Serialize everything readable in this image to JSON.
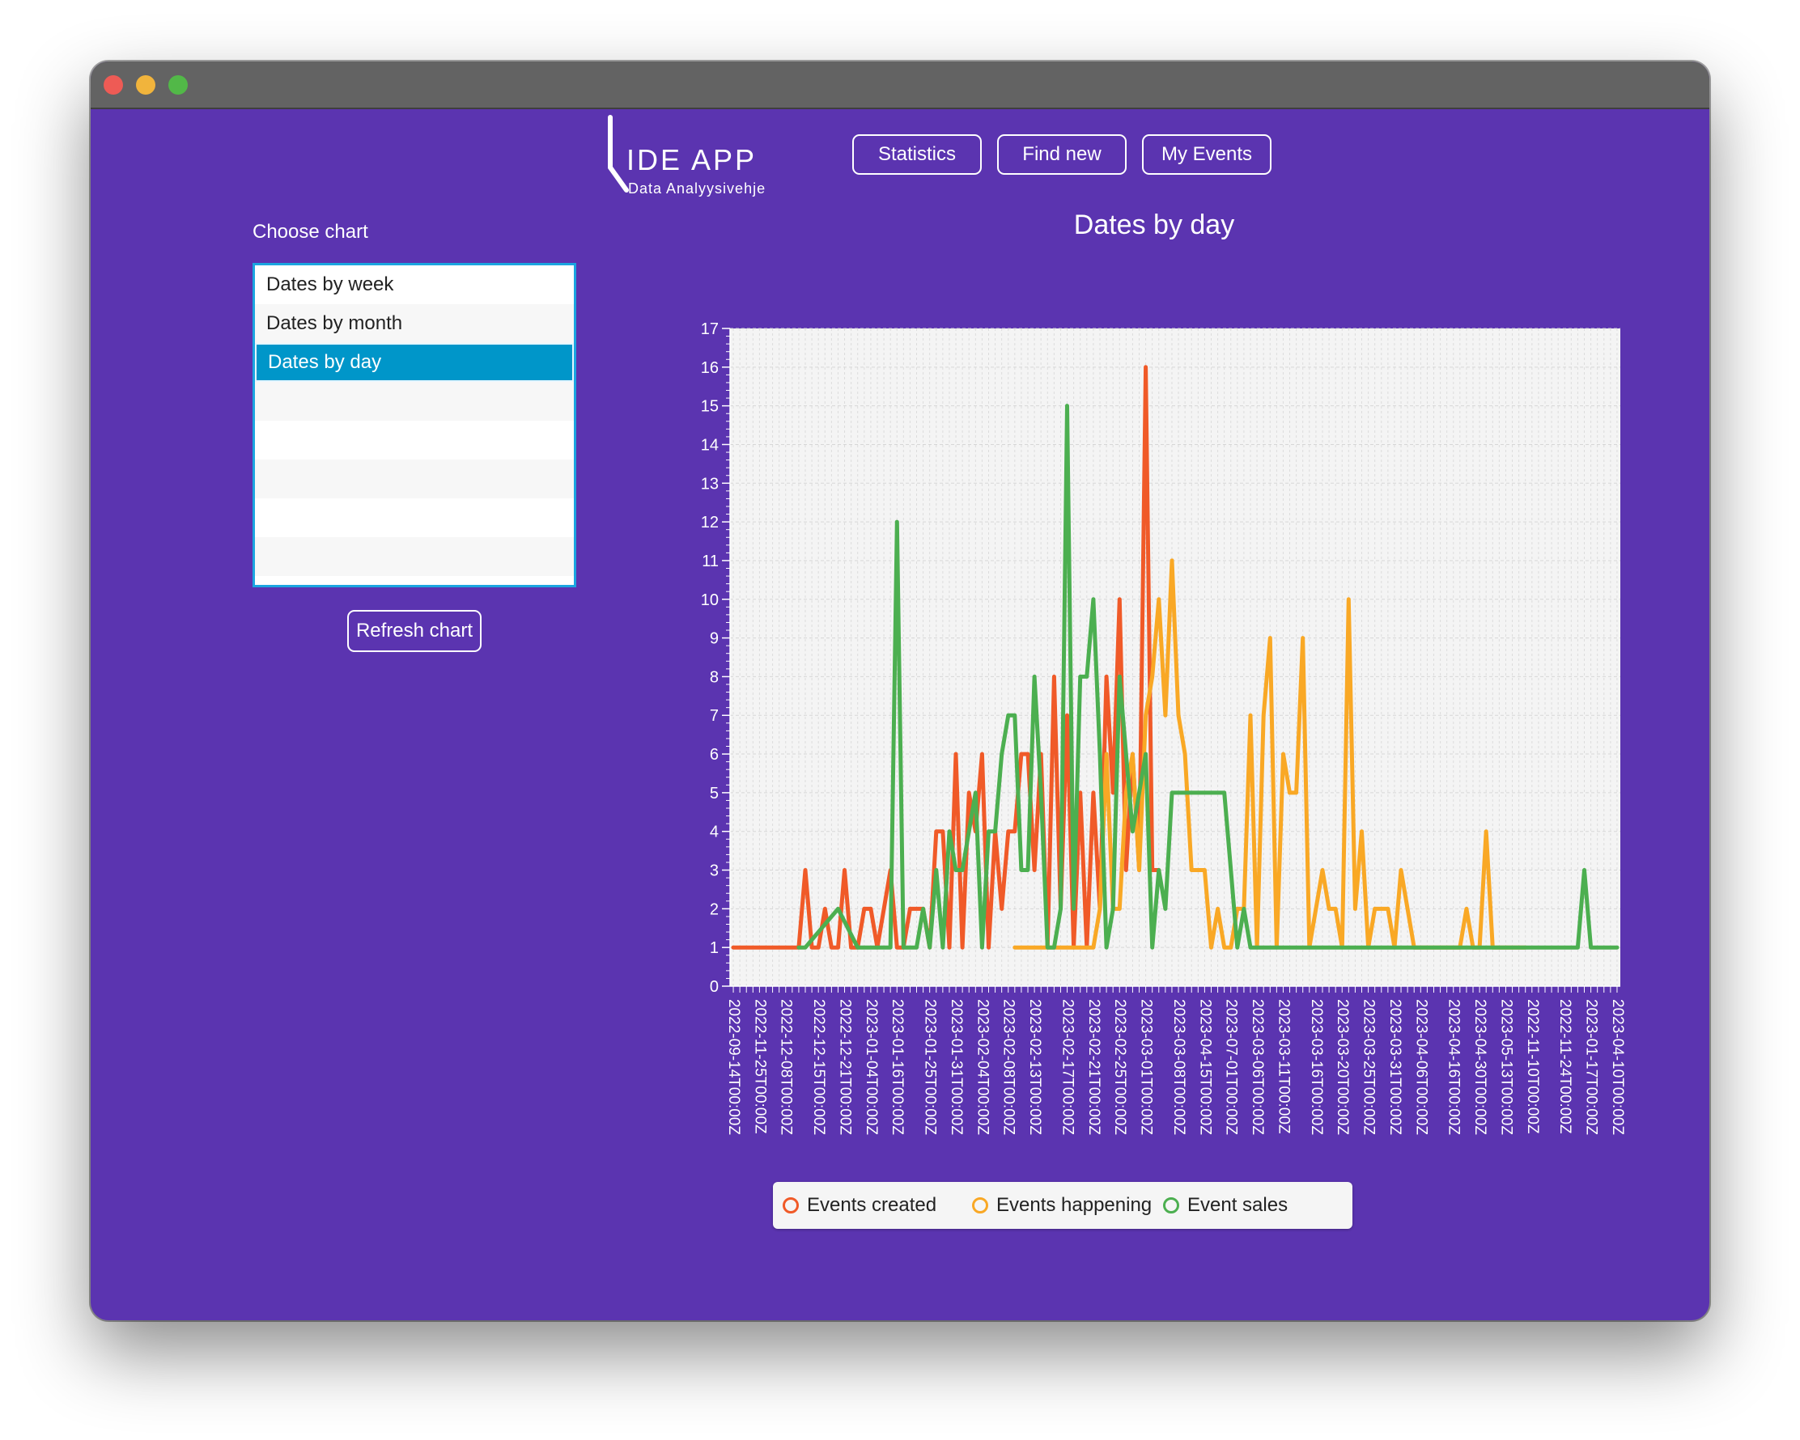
{
  "app": {
    "logo_title": "IDE APP",
    "logo_subtitle": "Data Analyysivehje"
  },
  "nav": {
    "statistics_label": "Statistics",
    "find_new_label": "Find new",
    "my_events_label": "My Events"
  },
  "sidebar": {
    "choose_label": "Choose chart",
    "items": [
      {
        "label": "Dates by week"
      },
      {
        "label": "Dates by month"
      },
      {
        "label": "Dates by day"
      }
    ],
    "selected_index": 2,
    "refresh_label": "Refresh chart"
  },
  "colors": {
    "window_bg": "#5b34b0",
    "created": "#f05a28",
    "happening": "#f9a825",
    "sales": "#4caf50"
  },
  "chart_data": {
    "type": "line",
    "title": "Dates by day",
    "xlabel": "",
    "ylabel": "",
    "ylim": [
      0,
      17
    ],
    "y_ticks": [
      0,
      1,
      2,
      3,
      4,
      5,
      6,
      7,
      8,
      9,
      10,
      11,
      12,
      13,
      14,
      15,
      16,
      17
    ],
    "grid": true,
    "legend_position": "bottom",
    "category_count": 136,
    "x_tick_labels": [
      "2022-09-14T00:00Z",
      "2022-11-25T00:00Z",
      "2022-12-08T00:00Z",
      "2022-12-15T00:00Z",
      "2022-12-21T00:00Z",
      "2023-01-04T00:00Z",
      "2023-01-16T00:00Z",
      "2023-01-25T00:00Z",
      "2023-01-31T00:00Z",
      "2023-02-04T00:00Z",
      "2023-02-08T00:00Z",
      "2023-02-13T00:00Z",
      "2023-02-17T00:00Z",
      "2023-02-21T00:00Z",
      "2023-02-25T00:00Z",
      "2023-03-01T00:00Z",
      "2023-03-08T00:00Z",
      "2023-04-15T00:00Z",
      "2023-07-01T00:00Z",
      "2023-03-06T00:00Z",
      "2023-03-11T00:00Z",
      "2023-03-16T00:00Z",
      "2023-03-20T00:00Z",
      "2023-03-25T00:00Z",
      "2023-03-31T00:00Z",
      "2023-04-06T00:00Z",
      "2023-04-16T00:00Z",
      "2023-04-30T00:00Z",
      "2023-05-13T00:00Z",
      "2022-11-10T00:00Z",
      "2022-11-24T00:00Z",
      "2023-01-17T00:00Z",
      "2023-04-10T00:00Z"
    ],
    "series": [
      {
        "name": "Events created",
        "values": [
          [
            0,
            1
          ],
          [
            10,
            1
          ],
          [
            11,
            3
          ],
          [
            12,
            1
          ],
          [
            13,
            1
          ],
          [
            14,
            2
          ],
          [
            15,
            1
          ],
          [
            16,
            1
          ],
          [
            17,
            3
          ],
          [
            18,
            1
          ],
          [
            19,
            1
          ],
          [
            20,
            2
          ],
          [
            21,
            2
          ],
          [
            22,
            1
          ],
          [
            23,
            2
          ],
          [
            24,
            3
          ],
          [
            25,
            1
          ],
          [
            26,
            1
          ],
          [
            27,
            2
          ],
          [
            28,
            2
          ],
          [
            29,
            2
          ],
          [
            30,
            1
          ],
          [
            31,
            4
          ],
          [
            32,
            4
          ],
          [
            33,
            1
          ],
          [
            34,
            6
          ],
          [
            35,
            1
          ],
          [
            36,
            5
          ],
          [
            37,
            4
          ],
          [
            38,
            6
          ],
          [
            39,
            1
          ],
          [
            40,
            4
          ],
          [
            41,
            2
          ],
          [
            42,
            4
          ],
          [
            43,
            4
          ],
          [
            44,
            6
          ],
          [
            45,
            6
          ],
          [
            46,
            3
          ],
          [
            47,
            6
          ],
          [
            48,
            1
          ],
          [
            49,
            8
          ],
          [
            50,
            2
          ],
          [
            51,
            7
          ],
          [
            52,
            1
          ],
          [
            53,
            5
          ],
          [
            54,
            1
          ],
          [
            55,
            5
          ],
          [
            56,
            2
          ],
          [
            57,
            8
          ],
          [
            58,
            5
          ],
          [
            59,
            10
          ],
          [
            60,
            3
          ],
          [
            61,
            6
          ],
          [
            62,
            3
          ],
          [
            63,
            16
          ],
          [
            64,
            3
          ],
          [
            65,
            3
          ]
        ]
      },
      {
        "name": "Events happening",
        "values": [
          [
            43,
            1
          ],
          [
            49,
            1
          ],
          [
            50,
            1
          ],
          [
            51,
            1
          ],
          [
            52,
            1
          ],
          [
            53,
            1
          ],
          [
            54,
            1
          ],
          [
            55,
            1
          ],
          [
            56,
            2
          ],
          [
            57,
            6
          ],
          [
            58,
            2
          ],
          [
            59,
            2
          ],
          [
            60,
            5
          ],
          [
            61,
            6
          ],
          [
            62,
            3
          ],
          [
            63,
            7
          ],
          [
            64,
            8
          ],
          [
            65,
            10
          ],
          [
            66,
            7
          ],
          [
            67,
            11
          ],
          [
            68,
            7
          ],
          [
            69,
            6
          ],
          [
            70,
            3
          ],
          [
            71,
            3
          ],
          [
            72,
            3
          ],
          [
            73,
            1
          ],
          [
            74,
            2
          ],
          [
            75,
            1
          ],
          [
            76,
            1
          ],
          [
            77,
            2
          ],
          [
            78,
            2
          ],
          [
            79,
            7
          ],
          [
            80,
            1
          ],
          [
            81,
            7
          ],
          [
            82,
            9
          ],
          [
            83,
            1
          ],
          [
            84,
            6
          ],
          [
            85,
            5
          ],
          [
            86,
            5
          ],
          [
            87,
            9
          ],
          [
            88,
            1
          ],
          [
            89,
            2
          ],
          [
            90,
            3
          ],
          [
            91,
            2
          ],
          [
            92,
            2
          ],
          [
            93,
            1
          ],
          [
            94,
            10
          ],
          [
            95,
            2
          ],
          [
            96,
            4
          ],
          [
            97,
            1
          ],
          [
            98,
            2
          ],
          [
            99,
            2
          ],
          [
            100,
            2
          ],
          [
            101,
            1
          ],
          [
            102,
            3
          ],
          [
            103,
            2
          ],
          [
            104,
            1
          ],
          [
            105,
            1
          ],
          [
            106,
            1
          ],
          [
            107,
            1
          ],
          [
            108,
            1
          ],
          [
            109,
            1
          ],
          [
            110,
            1
          ],
          [
            111,
            1
          ],
          [
            112,
            2
          ],
          [
            113,
            1
          ],
          [
            114,
            1
          ],
          [
            115,
            4
          ],
          [
            116,
            1
          ],
          [
            117,
            1
          ],
          [
            118,
            1
          ],
          [
            119,
            1
          ],
          [
            120,
            1
          ],
          [
            121,
            1
          ]
        ]
      },
      {
        "name": "Event sales",
        "values": [
          [
            10,
            1
          ],
          [
            11,
            1
          ],
          [
            16,
            2
          ],
          [
            19,
            1
          ],
          [
            20,
            1
          ],
          [
            21,
            1
          ],
          [
            22,
            1
          ],
          [
            23,
            1
          ],
          [
            24,
            1
          ],
          [
            25,
            12
          ],
          [
            26,
            1
          ],
          [
            27,
            1
          ],
          [
            28,
            1
          ],
          [
            29,
            2
          ],
          [
            30,
            1
          ],
          [
            31,
            3
          ],
          [
            32,
            1
          ],
          [
            33,
            4
          ],
          [
            34,
            3
          ],
          [
            35,
            3
          ],
          [
            36,
            4
          ],
          [
            37,
            5
          ],
          [
            38,
            1
          ],
          [
            39,
            4
          ],
          [
            40,
            4
          ],
          [
            41,
            6
          ],
          [
            42,
            7
          ],
          [
            43,
            7
          ],
          [
            44,
            3
          ],
          [
            45,
            3
          ],
          [
            46,
            8
          ],
          [
            47,
            5
          ],
          [
            48,
            1
          ],
          [
            49,
            1
          ],
          [
            50,
            2
          ],
          [
            51,
            15
          ],
          [
            52,
            2
          ],
          [
            53,
            8
          ],
          [
            54,
            8
          ],
          [
            55,
            10
          ],
          [
            56,
            6
          ],
          [
            57,
            1
          ],
          [
            58,
            2
          ],
          [
            59,
            8
          ],
          [
            60,
            6
          ],
          [
            61,
            4
          ],
          [
            62,
            5
          ],
          [
            63,
            6
          ],
          [
            64,
            1
          ],
          [
            65,
            3
          ],
          [
            66,
            2
          ],
          [
            67,
            5
          ],
          [
            75,
            5
          ],
          [
            76,
            3
          ],
          [
            77,
            1
          ],
          [
            78,
            2
          ],
          [
            79,
            1
          ],
          [
            80,
            1
          ],
          [
            81,
            1
          ],
          [
            82,
            1
          ],
          [
            83,
            1
          ],
          [
            84,
            1
          ],
          [
            85,
            1
          ],
          [
            86,
            1
          ],
          [
            87,
            1
          ],
          [
            88,
            1
          ],
          [
            89,
            1
          ],
          [
            90,
            1
          ],
          [
            91,
            1
          ],
          [
            92,
            1
          ],
          [
            93,
            1
          ],
          [
            94,
            1
          ],
          [
            95,
            1
          ],
          [
            96,
            1
          ],
          [
            97,
            1
          ],
          [
            98,
            1
          ],
          [
            99,
            1
          ],
          [
            100,
            1
          ],
          [
            101,
            1
          ],
          [
            102,
            1
          ],
          [
            103,
            1
          ],
          [
            104,
            1
          ],
          [
            105,
            1
          ],
          [
            106,
            1
          ],
          [
            107,
            1
          ],
          [
            108,
            1
          ],
          [
            109,
            1
          ],
          [
            110,
            1
          ],
          [
            111,
            1
          ],
          [
            112,
            1
          ],
          [
            113,
            1
          ],
          [
            114,
            1
          ],
          [
            115,
            1
          ],
          [
            116,
            1
          ],
          [
            117,
            1
          ],
          [
            118,
            1
          ],
          [
            119,
            1
          ],
          [
            120,
            1
          ],
          [
            121,
            1
          ],
          [
            122,
            1
          ],
          [
            123,
            1
          ],
          [
            124,
            1
          ],
          [
            125,
            1
          ],
          [
            126,
            1
          ],
          [
            127,
            1
          ],
          [
            128,
            1
          ],
          [
            129,
            1
          ],
          [
            130,
            3
          ],
          [
            131,
            1
          ],
          [
            132,
            1
          ],
          [
            133,
            1
          ],
          [
            134,
            1
          ],
          [
            135,
            1
          ]
        ]
      }
    ]
  }
}
